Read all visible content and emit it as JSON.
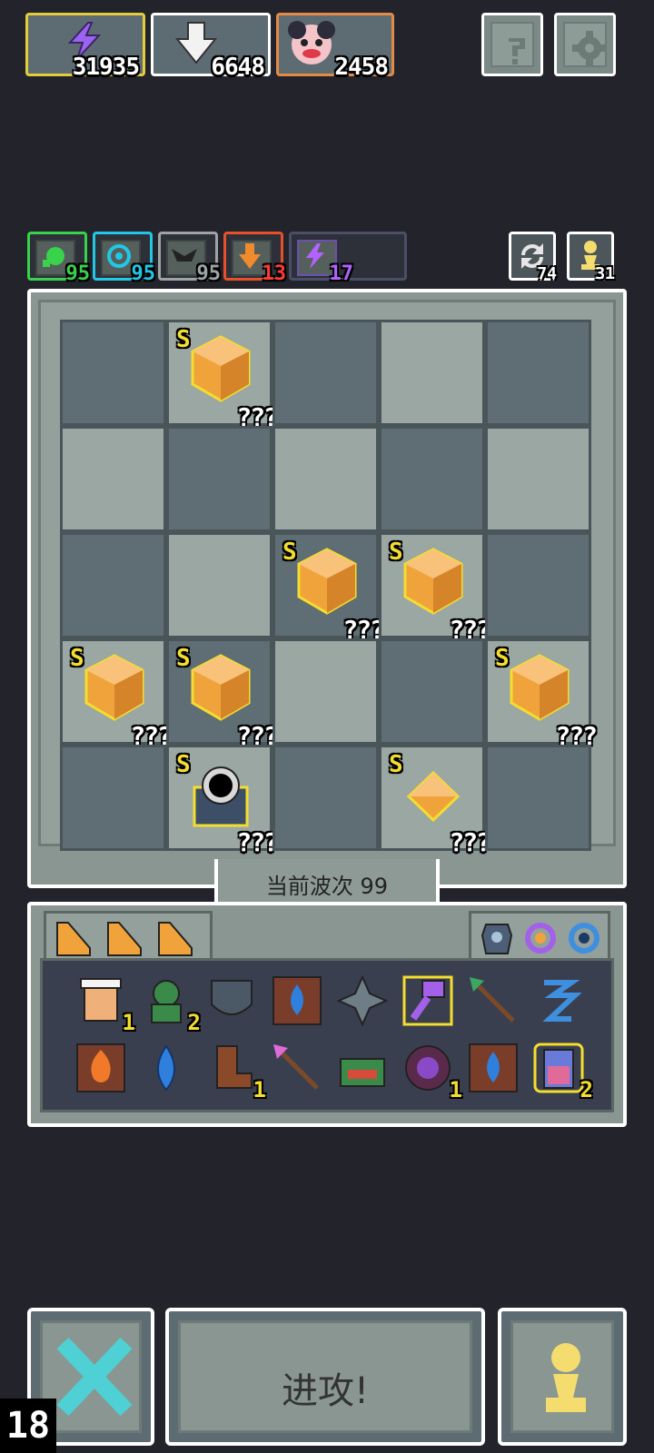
{
  "resources": [
    {
      "icon": "lightning-icon",
      "value": "31935",
      "border": "#e3cd3a"
    },
    {
      "icon": "down-arrow-icon",
      "value": "6648",
      "border": "#ffffff"
    },
    {
      "icon": "clown-portrait-icon",
      "value": "2458",
      "border": "#e58a45"
    }
  ],
  "top_buttons": [
    {
      "name": "help-button",
      "icon": "question-icon"
    },
    {
      "name": "settings-button",
      "icon": "gear-icon"
    }
  ],
  "stats": [
    {
      "icon": "green-orb-icon",
      "value": "95",
      "color": "#39d24b"
    },
    {
      "icon": "cyan-swirl-icon",
      "value": "95",
      "color": "#22c7e6"
    },
    {
      "icon": "wing-icon",
      "value": "95",
      "color": "#9ea3a6"
    },
    {
      "icon": "orange-arrow-icon",
      "value": "13",
      "color": "#ff3c32"
    },
    {
      "icon": "purple-bolt-icon",
      "value": "17",
      "color": "#b362ff"
    }
  ],
  "right_stats": [
    {
      "icon": "refresh-icon",
      "value": "74"
    },
    {
      "icon": "pawn-icon",
      "value": "31"
    }
  ],
  "board": {
    "rank_label": "S",
    "unknown_label": "???",
    "wave_text": "当前波次 99"
  },
  "inventory": {
    "counts": [
      "1",
      "2",
      "1",
      "1",
      "1",
      "2"
    ]
  },
  "buttons": {
    "attack_label": "进攻!"
  },
  "counter": "18",
  "colors": {
    "background": "#23232b",
    "gem": "#f0a33a",
    "rank": "#f4dd2e"
  }
}
